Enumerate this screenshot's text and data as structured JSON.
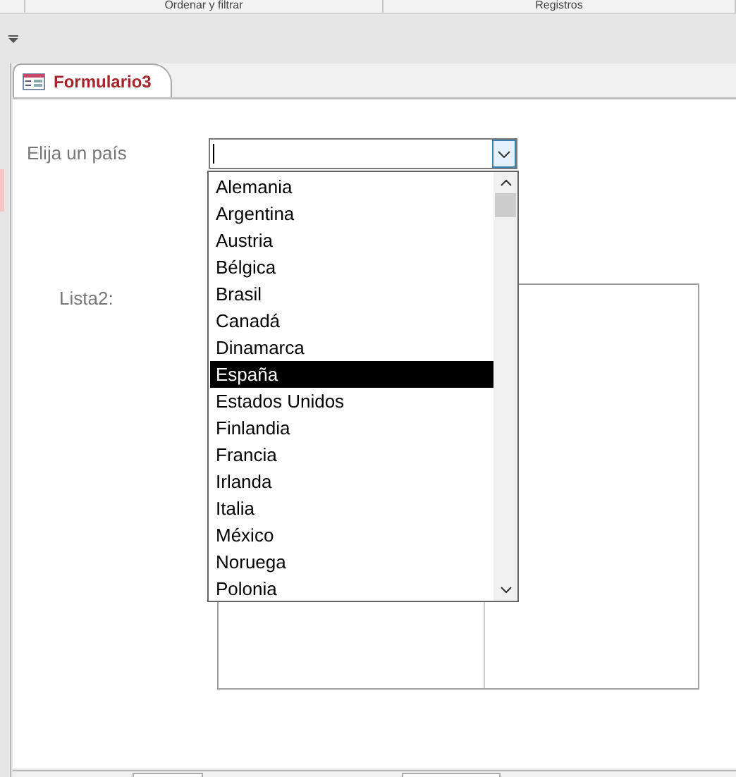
{
  "ribbon_groups": [
    "Ordenar y filtrar",
    "Registros"
  ],
  "tabs": [
    {
      "label": "Formulario3",
      "selected": true
    }
  ],
  "form": {
    "combo_label": "Elija un país",
    "list_label": "Lista2:",
    "dropdown": {
      "expanded": true,
      "items": [
        {
          "label": "Alemania",
          "selected": false
        },
        {
          "label": "Argentina",
          "selected": false
        },
        {
          "label": "Austria",
          "selected": false
        },
        {
          "label": "Bélgica",
          "selected": false
        },
        {
          "label": "Brasil",
          "selected": false
        },
        {
          "label": "Canadá",
          "selected": false
        },
        {
          "label": "Dinamarca",
          "selected": false
        },
        {
          "label": "España",
          "selected": true
        },
        {
          "label": "Estados Unidos",
          "selected": false
        },
        {
          "label": "Finlandia",
          "selected": false
        },
        {
          "label": "Francia",
          "selected": false
        },
        {
          "label": "Irlanda",
          "selected": false
        },
        {
          "label": "Italia",
          "selected": false
        },
        {
          "label": "México",
          "selected": false
        },
        {
          "label": "Noruega",
          "selected": false
        },
        {
          "label": "Polonia",
          "selected": false
        }
      ]
    }
  }
}
